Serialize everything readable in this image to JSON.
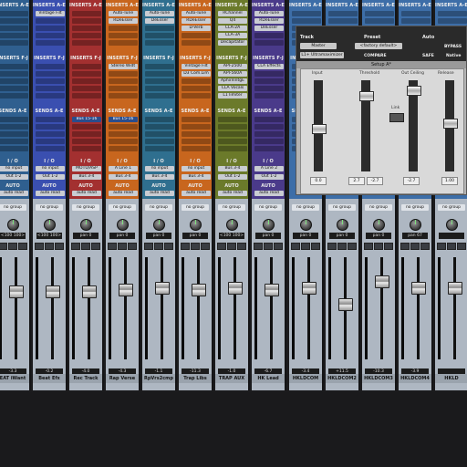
{
  "window_title": "Setup A*",
  "section_labels": {
    "inserts_ae": "INSERTS A-E",
    "inserts_fj": "INSERTS F-J",
    "sends_ae": "SENDS A-E",
    "io": "I / O",
    "auto": "AUTO"
  },
  "strips": [
    {
      "name": "EAT iWant",
      "color": "#2f5f8f",
      "inserts": [],
      "inserts2": [],
      "sends": [],
      "input": "no input",
      "output": "Out 1-2",
      "auto": "auto read",
      "group": "no group",
      "pan": "<100  100>",
      "volume": "-3.3"
    },
    {
      "name": "Beat Efx",
      "color": "#3a4fb0",
      "inserts": [
        "Vintage Filt"
      ],
      "inserts2": [],
      "sends": [],
      "input": "no input",
      "output": "Out 1-2",
      "auto": "auto read",
      "group": "no group",
      "pan": "<100  100>",
      "volume": "-0.2"
    },
    {
      "name": "Rec Track",
      "color": "#a33030",
      "inserts": [],
      "inserts2": [],
      "sends": [
        "Bus 15-16"
      ],
      "input": "MOTU/ASP",
      "output": "Bus 3-4",
      "auto": "auto read",
      "group": "no group",
      "pan": "pan  0",
      "volume": "-4.0"
    },
    {
      "name": "Rap Verse",
      "color": "#c8661e",
      "inserts": [
        "Auto-Tune",
        "RDeEsser"
      ],
      "inserts2": [
        "Stereo Widt"
      ],
      "sends": [
        "Bus 15-16"
      ],
      "input": "A Line 1",
      "output": "Bus 3-4",
      "auto": "auto read",
      "group": "no group",
      "pan": "pan  0",
      "volume": "-4.3"
    },
    {
      "name": "RpVrs2cmp",
      "color": "#2f6f8f",
      "inserts": [
        "Auto-Tune",
        "DeEsser"
      ],
      "inserts2": [],
      "sends": [],
      "input": "no input",
      "output": "Bus 3-4",
      "auto": "auto read",
      "group": "no group",
      "pan": "pan  0",
      "volume": "-1.1"
    },
    {
      "name": "Trap Libs",
      "color": "#c8661e",
      "inserts": [
        "Auto-Tune",
        "RDeEsser",
        "D-Verb"
      ],
      "inserts2": [
        "Vintage Filt",
        "D3 Com.Lim"
      ],
      "sends": [],
      "input": "no input",
      "output": "Bus 3-4",
      "auto": "auto read",
      "group": "no group",
      "pan": "pan  0",
      "volume": "-11.3"
    },
    {
      "name": "TRAP AUX",
      "color": "#6b7a2a",
      "inserts": [
        "RChannel",
        "Q4",
        "CLA-2A",
        "CLA-3A",
        "Decapitator"
      ],
      "inserts2": [
        "API-2500",
        "API-560A",
        "AphxVintgE",
        "CLA Vocals",
        "L1 limiter"
      ],
      "sends": [],
      "input": "Bus 3-4",
      "output": "Out 1-2",
      "auto": "auto read",
      "group": "no group",
      "pan": "<100  100>",
      "volume": "-1.0"
    },
    {
      "name": "HK Lead",
      "color": "#4a3a8a",
      "inserts": [
        "Auto-Tune",
        "RDeEsser",
        "DeEsser"
      ],
      "inserts2": [
        "CLA Effects"
      ],
      "sends": [],
      "input": "A Line 2",
      "output": "Out 1-2",
      "auto": "auto read",
      "group": "no group",
      "pan": "pan  0",
      "volume": "-6.7"
    },
    {
      "name": "HKLDCOM",
      "color": "#3d6ea8",
      "inserts": [],
      "inserts2": [],
      "sends": [],
      "input": "",
      "output": "",
      "auto": "",
      "group": "no group",
      "pan": "pan  0",
      "volume": "-3.4"
    },
    {
      "name": "HKLDCOM2",
      "color": "#3d6ea8",
      "inserts": [],
      "inserts2": [],
      "sends": [],
      "input": "",
      "output": "",
      "auto": "",
      "group": "no group",
      "pan": "pan  0",
      "volume": "+11.5"
    },
    {
      "name": "HKLDCOM3",
      "color": "#3d6ea8",
      "inserts": [],
      "inserts2": [],
      "sends": [],
      "input": "",
      "output": "",
      "auto": "",
      "group": "no group",
      "pan": "pan  0",
      "volume": "-10.3"
    },
    {
      "name": "HKLDCOM4",
      "color": "#3d6ea8",
      "inserts": [],
      "inserts2": [],
      "sends": [],
      "input": "",
      "output": "",
      "auto": "",
      "group": "no group",
      "pan": "pan  67",
      "volume": "-3.9"
    },
    {
      "name": "HKLD",
      "color": "#3d6ea8",
      "inserts": [],
      "inserts2": [],
      "sends": [],
      "input": "",
      "output": "",
      "auto": "",
      "group": "no group",
      "pan": "",
      "volume": ""
    }
  ],
  "fader_levels": [
    0.72,
    0.72,
    0.72,
    0.74,
    0.76,
    0.74,
    0.76,
    0.74,
    0.76,
    0.6,
    0.82,
    0.76,
    0.76
  ],
  "plugin": {
    "track_label": "Track",
    "preset_label": "Preset",
    "auto_label": "Auto",
    "track_value": "Master",
    "plugin_name": "L1+ Ultramaximizer",
    "preset_value": "<factory default>",
    "compare": "COMPARE",
    "safe": "SAFE",
    "bypass": "BYPASS",
    "native": "Native",
    "setup": "Setup A*",
    "col_input": "Input",
    "col_threshold": "Threshold",
    "col_out_ceiling": "Out Ceiling",
    "col_release": "Release",
    "link": "Link",
    "values": [
      "0.0",
      "2.7",
      "-2.7",
      "-2.7",
      "1.00"
    ]
  }
}
